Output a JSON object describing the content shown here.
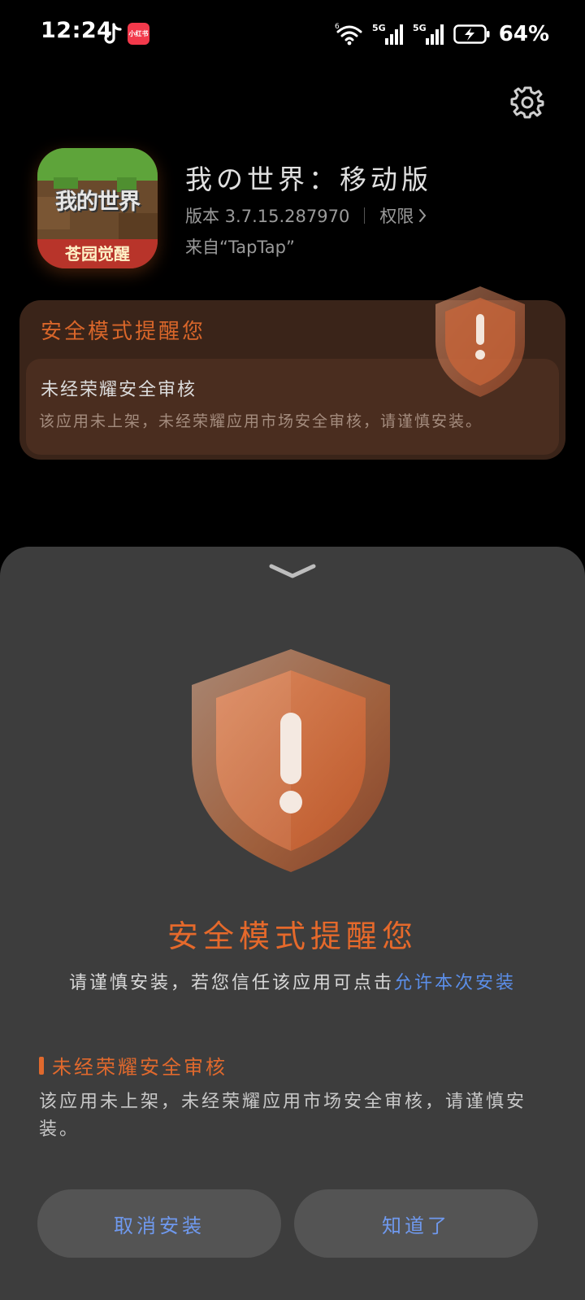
{
  "status_bar": {
    "time": "12:24",
    "battery": "64%",
    "xhs_label": "小红书",
    "net_1": "5G",
    "net_2": "5G",
    "wifi_sub": "6"
  },
  "app": {
    "name": "我の世界：移动版",
    "version": "版本 3.7.15.287970",
    "permissions_label": "权限",
    "source": "来自“TapTap”",
    "icon_logo_text": "我的世界",
    "icon_sub_text": "苍园觉醒"
  },
  "warning_card": {
    "title": "安全模式提醒您",
    "subtitle": "未经荣耀安全审核",
    "text": "该应用未上架，未经荣耀应用市场安全审核，请谨慎安装。"
  },
  "sheet": {
    "title": "安全模式提醒您",
    "desc_prefix": "请谨慎安装，若您信任该应用可点击",
    "desc_link": "允许本次安装",
    "reason_title": "未经荣耀安全审核",
    "reason_text": "该应用未上架，未经荣耀应用市场安全审核，请谨慎安装。",
    "cancel_label": "取消安装",
    "ok_label": "知道了"
  },
  "colors": {
    "accent_orange": "#e5692b",
    "link_blue": "#5b8ee8",
    "sheet_bg": "#3d3d3d"
  }
}
